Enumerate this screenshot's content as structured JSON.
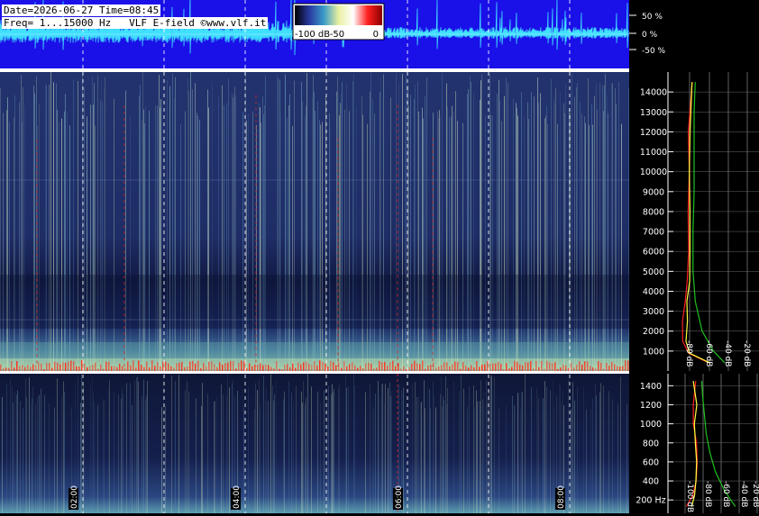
{
  "header": {
    "date_time": "Date=2026-06-27 Time=08:45",
    "freq_info": "Freq= 1...15000 Hz   VLF E-field ©www.vlf.it"
  },
  "colorbar": {
    "labels": [
      "-100 dB",
      "-50",
      "0"
    ],
    "colors": [
      "#000000",
      "#2a3aa0",
      "#3a9cc8",
      "#e8f0a0",
      "#ffffff",
      "#ff2020",
      "#8a0000"
    ]
  },
  "waveform": {
    "tick_labels": [
      "50 %",
      "0 %",
      "-50 %"
    ],
    "background": "#1a10e8",
    "trace_color": "#40e0ff"
  },
  "time_axis": {
    "labels": [
      "02:00",
      "04:00",
      "06:00",
      "08:00"
    ]
  },
  "chart_data": [
    {
      "type": "heatmap",
      "name": "upper-spectrogram",
      "x_range": [
        "00:45",
        "08:45"
      ],
      "y_range_hz": [
        1,
        15000
      ],
      "colorscale_db": [
        -100,
        0
      ],
      "ticks_hz": [
        "1000",
        "2000",
        "3000",
        "4000",
        "5000",
        "6000",
        "7000",
        "8000",
        "9000",
        "10000",
        "11000",
        "12000",
        "13000",
        "14000"
      ]
    },
    {
      "type": "heatmap",
      "name": "lower-spectrogram",
      "x_range": [
        "00:45",
        "08:45"
      ],
      "y_range_hz": [
        1,
        1500
      ],
      "colorscale_db": [
        -100,
        0
      ],
      "ticks_hz": [
        "200 Hz",
        "400",
        "600",
        "800",
        "1000",
        "1200",
        "1400"
      ]
    },
    {
      "type": "line",
      "name": "upper-spectrum-profile",
      "x_labels": [
        "-80 dB",
        "-60 dB",
        "-40 dB",
        "-20 dB"
      ],
      "x_range_db": [
        -90,
        -10
      ],
      "y_range_hz": [
        0,
        15000
      ],
      "series": [
        {
          "color": "#ff2020",
          "points": [
            [
              -55,
              400
            ],
            [
              -72,
              900
            ],
            [
              -76,
              1500
            ],
            [
              -76,
              2500
            ],
            [
              -74,
              3500
            ],
            [
              -73,
              4500
            ],
            [
              -72,
              6000
            ],
            [
              -72,
              8000
            ],
            [
              -72,
              10000
            ],
            [
              -71,
              12000
            ],
            [
              -70,
              14500
            ]
          ]
        },
        {
          "color": "#ffff40",
          "points": [
            [
              -52,
              400
            ],
            [
              -70,
              900
            ],
            [
              -74,
              1500
            ],
            [
              -74,
              2500
            ],
            [
              -72,
              3500
            ],
            [
              -71,
              4500
            ],
            [
              -70,
              6000
            ],
            [
              -71,
              8000
            ],
            [
              -71,
              10000
            ],
            [
              -70,
              12000
            ],
            [
              -69,
              14500
            ]
          ]
        },
        {
          "color": "#20c020",
          "points": [
            [
              -40,
              400
            ],
            [
              -50,
              1000
            ],
            [
              -60,
              2000
            ],
            [
              -66,
              3500
            ],
            [
              -68,
              5000
            ],
            [
              -68,
              7000
            ],
            [
              -67,
              9000
            ],
            [
              -67,
              11000
            ],
            [
              -67,
              13000
            ],
            [
              -66,
              14500
            ]
          ]
        }
      ]
    },
    {
      "type": "line",
      "name": "lower-spectrum-profile",
      "x_labels": [
        "-100 dB",
        "-80 dB",
        "-60 dB",
        "-40 dB",
        "-20 dB"
      ],
      "x_range_db": [
        -110,
        -10
      ],
      "y_range_hz": [
        100,
        1500
      ],
      "series": [
        {
          "color": "#ff2020",
          "points": [
            [
              -88,
              130
            ],
            [
              -84,
              250
            ],
            [
              -80,
              400
            ],
            [
              -80,
              600
            ],
            [
              -81,
              800
            ],
            [
              -82,
              1000
            ],
            [
              -82,
              1200
            ],
            [
              -82,
              1450
            ]
          ]
        },
        {
          "color": "#ffff40",
          "points": [
            [
              -84,
              130
            ],
            [
              -80,
              250
            ],
            [
              -78,
              400
            ],
            [
              -78,
              600
            ],
            [
              -79,
              800
            ],
            [
              -80,
              1000
            ],
            [
              -80,
              1200
            ],
            [
              -80,
              1450
            ]
          ]
        },
        {
          "color": "#20c020",
          "points": [
            [
              -36,
              130
            ],
            [
              -48,
              300
            ],
            [
              -58,
              500
            ],
            [
              -64,
              700
            ],
            [
              -68,
              900
            ],
            [
              -70,
              1100
            ],
            [
              -72,
              1300
            ],
            [
              -73,
              1450
            ]
          ]
        }
      ]
    }
  ]
}
